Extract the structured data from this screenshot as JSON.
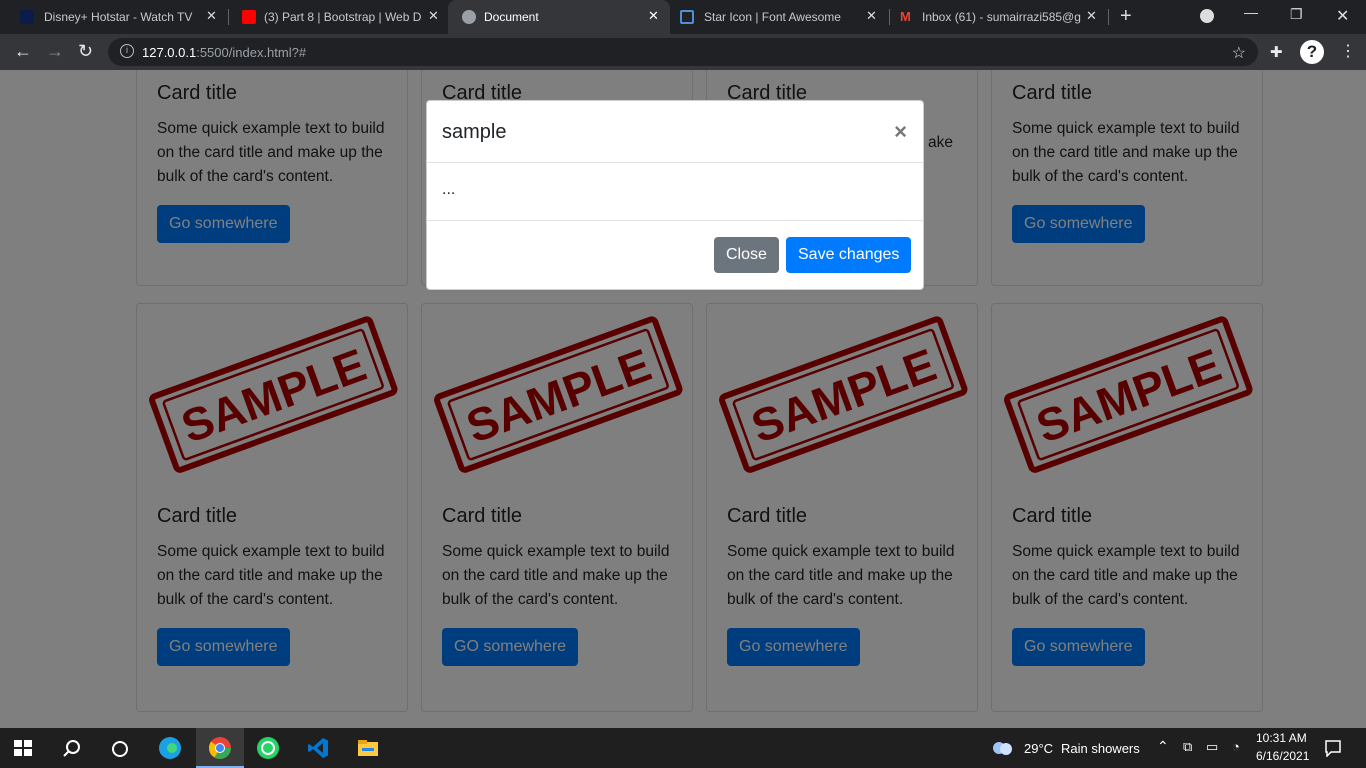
{
  "browser": {
    "tabs": [
      {
        "label": "Disney+ Hotstar - Watch TV S",
        "icon": "hotstar-icon",
        "color": "#0c1c4a"
      },
      {
        "label": "(3) Part 8 | Bootstrap | Web D",
        "icon": "youtube-icon",
        "color": "#ff0000"
      },
      {
        "label": "Document",
        "icon": "globe-icon",
        "color": "#9aa0a6"
      },
      {
        "label": "Star Icon | Font Awesome",
        "icon": "flag-icon",
        "color": "#528dd7"
      },
      {
        "label": "Inbox (61) - sumairrazi585@g",
        "icon": "gmail-icon",
        "color": "#ea4335"
      }
    ],
    "address_host": "127.0.0.1",
    "address_path": ":5500/index.html?#"
  },
  "cards_top": [
    {
      "title": "Card title",
      "text": "Some quick example text to build on the card title and make up the bulk of the card's content.",
      "button": "Go somewhere"
    },
    {
      "title": "Card title",
      "text": "",
      "button": ""
    },
    {
      "title": "Card title",
      "text": "ake",
      "button": ""
    },
    {
      "title": "Card title",
      "text": "Some quick example text to build on the card title and make up the bulk of the card's content.",
      "button": "Go somewhere"
    }
  ],
  "cards_bottom": [
    {
      "image_text": "SAMPLE",
      "title": "Card title",
      "text": "Some quick example text to build on the card title and make up the bulk of the card's content.",
      "button": "Go somewhere"
    },
    {
      "image_text": "SAMPLE",
      "title": "Card title",
      "text": "Some quick example text to build on the card title and make up the bulk of the card's content.",
      "button": "GO somewhere"
    },
    {
      "image_text": "SAMPLE",
      "title": "Card title",
      "text": "Some quick example text to build on the card title and make up the bulk of the card's content.",
      "button": "Go somewhere"
    },
    {
      "image_text": "SAMPLE",
      "title": "Card title",
      "text": "Some quick example text to build on the card title and make up the bulk of the card's content.",
      "button": "Go somewhere"
    }
  ],
  "modal": {
    "title": "sample",
    "close_glyph": "×",
    "body": "...",
    "close_label": "Close",
    "save_label": "Save changes"
  },
  "taskbar": {
    "weather_temp": "29°C",
    "weather_desc": "Rain showers",
    "time": "10:31 AM",
    "date": "6/16/2021"
  },
  "colors": {
    "primary": "#007bff",
    "secondary": "#6c757d",
    "stamp_red": "#b00000"
  }
}
